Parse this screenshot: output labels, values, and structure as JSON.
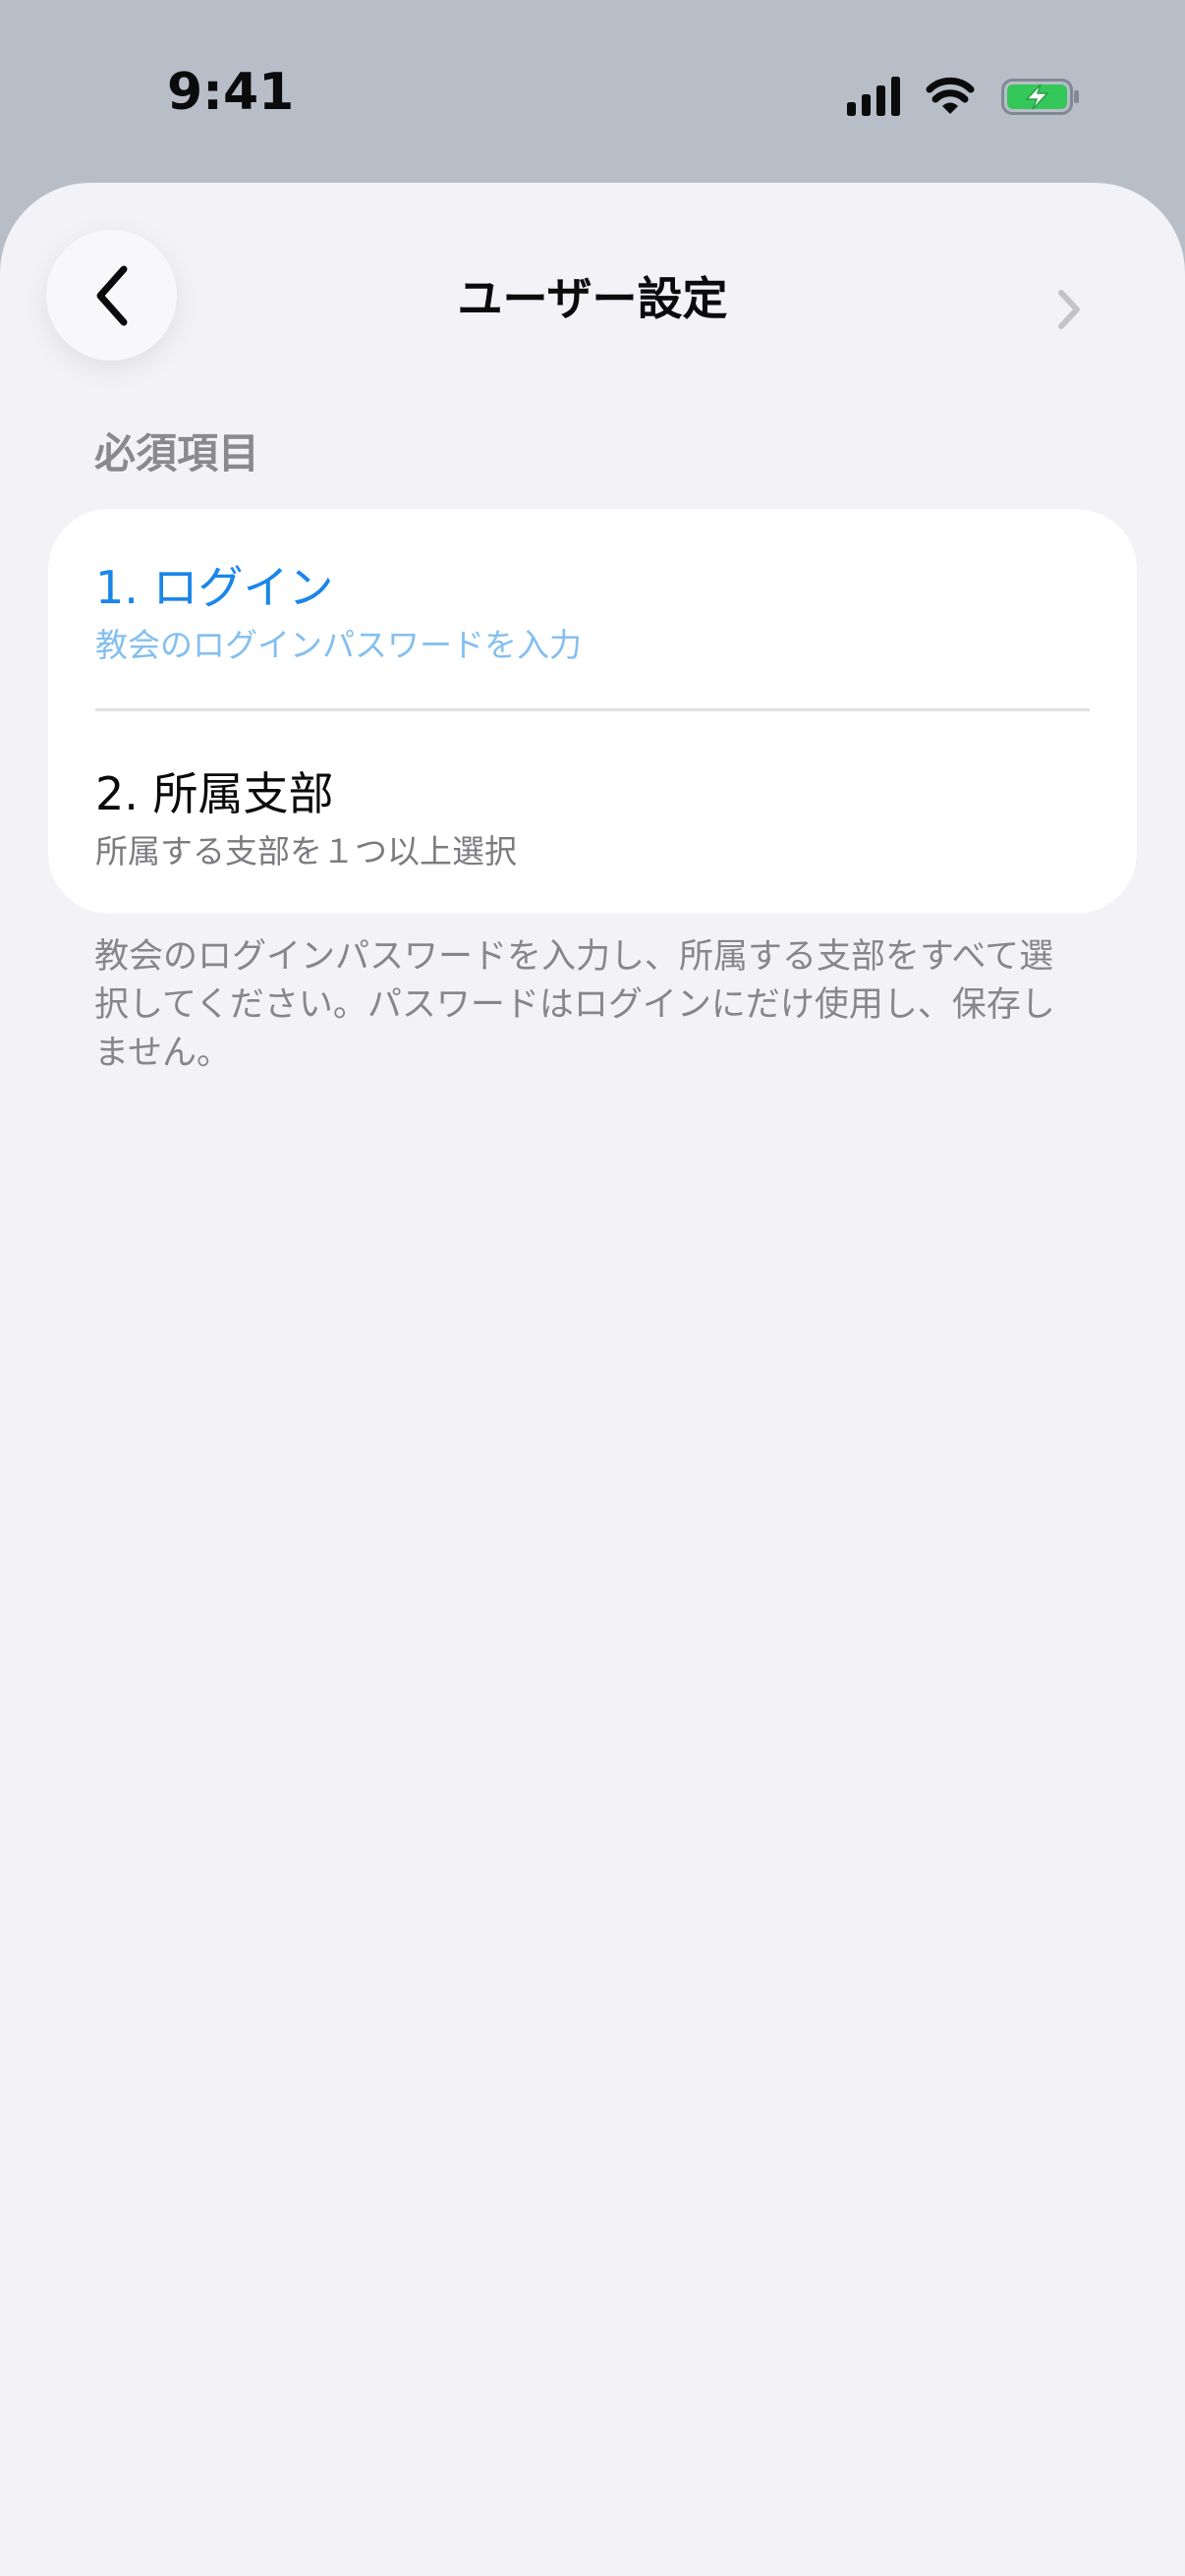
{
  "status_bar": {
    "time": "9:41",
    "icons": [
      "cellular-signal-icon",
      "wifi-icon",
      "battery-charging-icon"
    ],
    "battery_color": "#34c759"
  },
  "nav": {
    "back_icon": "chevron-left-icon",
    "title": "ユーザー設定"
  },
  "section": {
    "header": "必須項目",
    "items": [
      {
        "title": "1. ログイン",
        "subtitle": "教会のログインパスワードを入力",
        "active": true
      },
      {
        "title": "2. 所属支部",
        "subtitle": "所属する支部を１つ以上選択",
        "active": false
      }
    ],
    "footer": "教会のログインパスワードを入力し、所属する支部をすべて選択してください。パスワードはログインにだけ使用し、保存しません。"
  },
  "colors": {
    "accent": "#1a86e8",
    "accent_light": "#84bfef",
    "background": "#f2f2f7",
    "status_bar_background": "#b7bec7"
  }
}
